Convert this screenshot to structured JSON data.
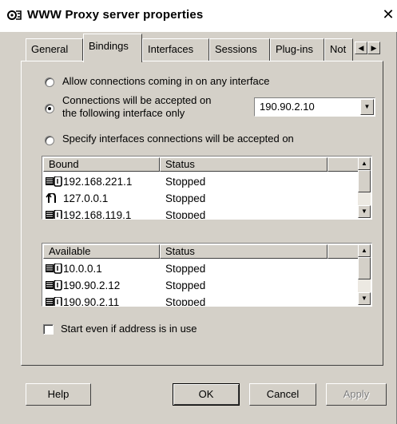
{
  "window": {
    "title": "WWW Proxy server properties",
    "close_glyph": "✕"
  },
  "tabs": [
    {
      "label": "General",
      "active": false
    },
    {
      "label": "Bindings",
      "active": true
    },
    {
      "label": "Interfaces",
      "active": false
    },
    {
      "label": "Sessions",
      "active": false
    },
    {
      "label": "Plug-ins",
      "active": false
    },
    {
      "label": "Not",
      "active": false
    }
  ],
  "tab_scroll": {
    "left_glyph": "◀",
    "right_glyph": "▶"
  },
  "bindings": {
    "option_any": "Allow connections coming in on any interface",
    "option_specific_line1": "Connections will be accepted on",
    "option_specific_line2": "the following interface only",
    "option_specify": "Specify interfaces connections will be accepted on",
    "selected_option": "specific",
    "interface_value": "190.90.2.10",
    "bound_list": {
      "headers": [
        "Bound",
        "Status"
      ],
      "rows": [
        {
          "address": "192.168.221.1",
          "status": "Stopped",
          "icon": "network-card-icon"
        },
        {
          "address": "127.0.0.1",
          "status": "Stopped",
          "icon": "loopback-icon"
        },
        {
          "address": "192.168.119.1",
          "status": "Stopped",
          "icon": "network-card-icon"
        }
      ]
    },
    "available_list": {
      "headers": [
        "Available",
        "Status"
      ],
      "rows": [
        {
          "address": "10.0.0.1",
          "status": "Stopped",
          "icon": "network-card-icon"
        },
        {
          "address": "190.90.2.12",
          "status": "Stopped",
          "icon": "network-card-icon"
        },
        {
          "address": "190.90.2.11",
          "status": "Stopped",
          "icon": "network-card-icon"
        }
      ]
    },
    "start_even_if_in_use": "Start even if address is in use",
    "start_even_if_in_use_checked": false
  },
  "buttons": {
    "help": "Help",
    "ok": "OK",
    "cancel": "Cancel",
    "apply": "Apply"
  },
  "scroll_glyphs": {
    "up": "▲",
    "down": "▼"
  }
}
